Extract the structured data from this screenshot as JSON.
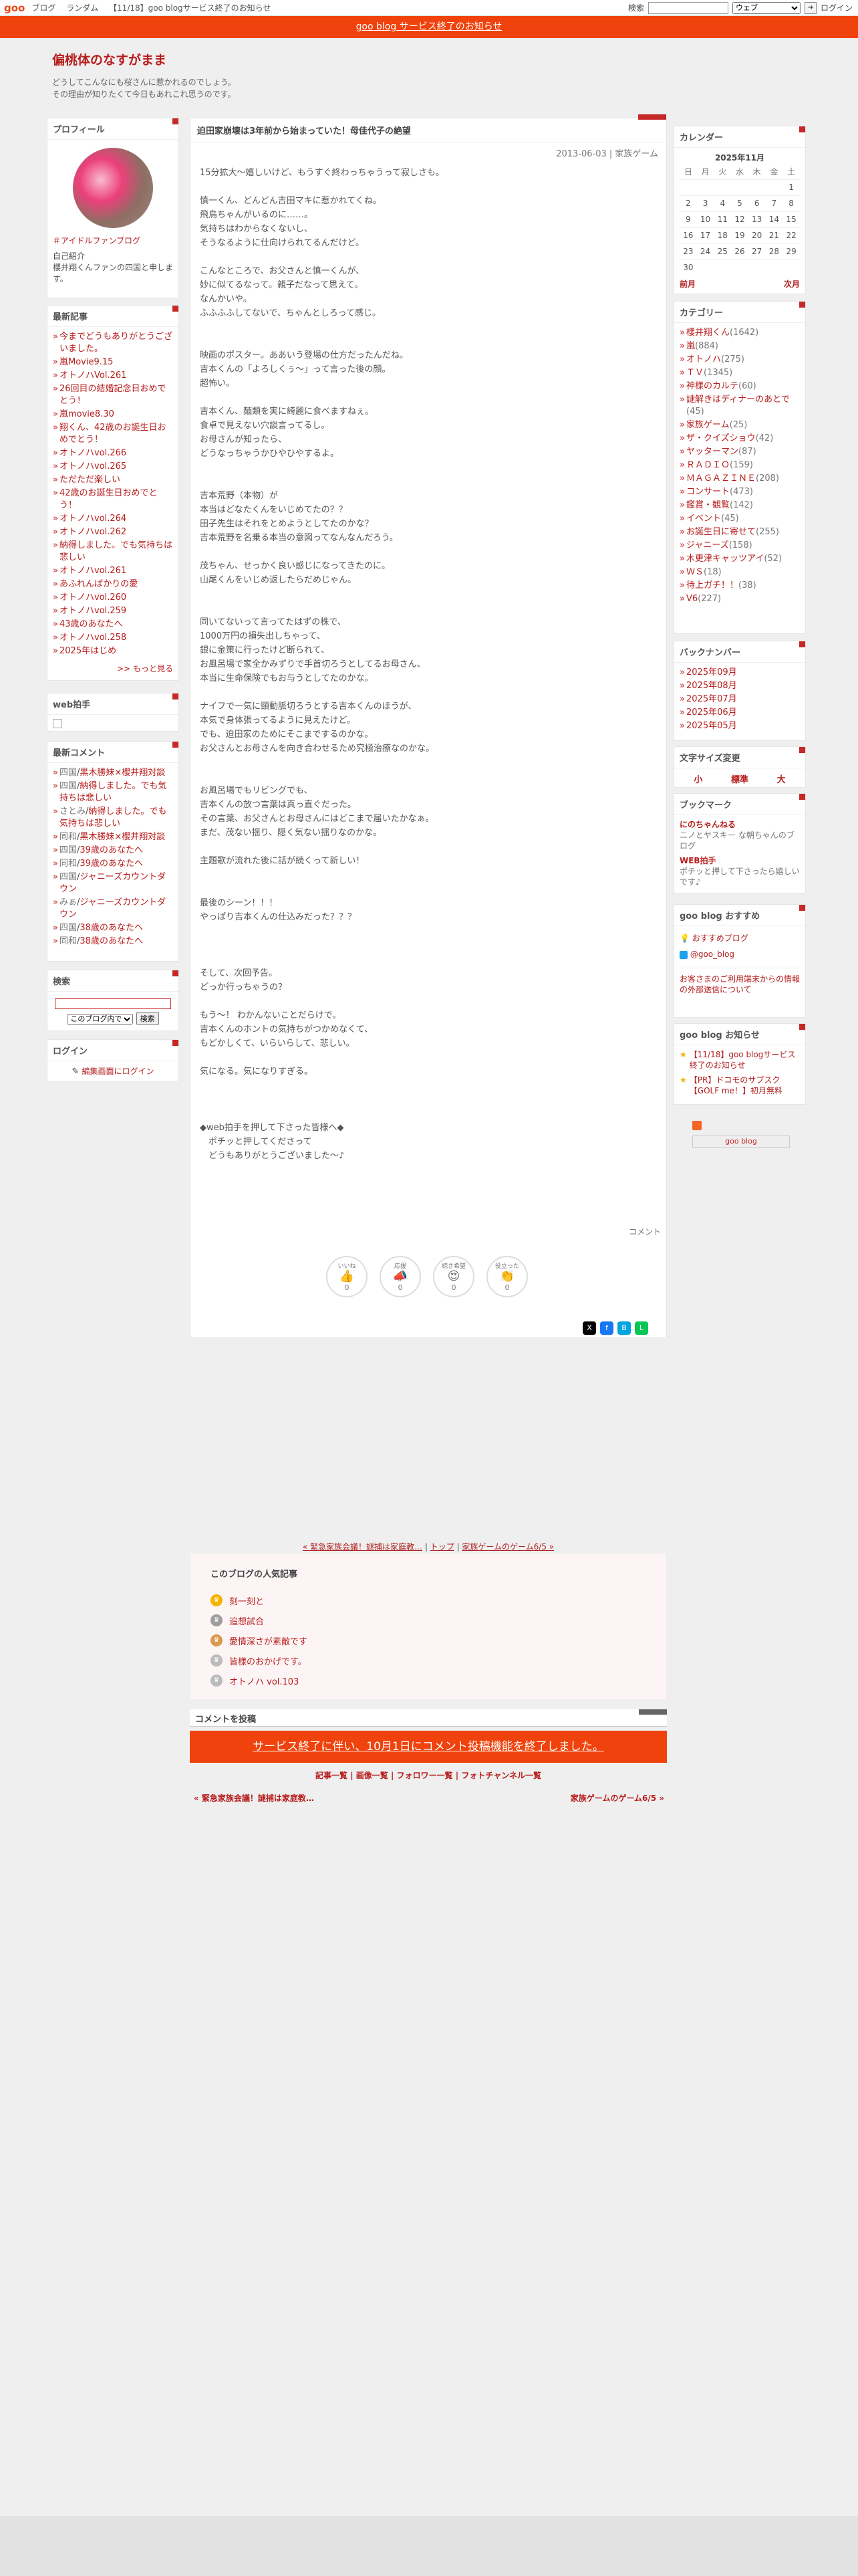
{
  "topbar": {
    "logo": "goo",
    "links": [
      "ブログ",
      "ランダム",
      "【11/18】goo blogサービス終了のお知らせ"
    ],
    "search_label": "検索",
    "select": "ウェブ",
    "login": "ログイン"
  },
  "notice": "goo blog サービス終了のお知らせ",
  "blog": {
    "title": "偏桃体のなすがまま",
    "desc1": "どうしてこんなにも桜さんに惹かれるのでしょう。",
    "desc2": "その理由が知りたくて今日もあれこれ思うのです。"
  },
  "profile": {
    "header": "プロフィール",
    "tag": "＃アイドルファンブログ",
    "intro_label": "自己紹介",
    "intro": "櫻井翔くんファンの四国と申します。"
  },
  "recent": {
    "header": "最新記事",
    "items": [
      "今までどうもありがとうございました。",
      "嵐Movie9.15",
      "オトノハVol.261",
      "26回目の結婚記念日おめでとう！",
      "嵐movie8.30",
      "翔くん、42歳のお誕生日おめでとう！",
      "オトノハvol.266",
      "オトノハvol.265",
      "ただただ楽しい",
      "42歳のお誕生日おめでとう！",
      "オトノハvol.264",
      "オトノハvol.262",
      "納得しました。でも気持ちは悲しい",
      "オトノハvol.261",
      "あふれんばかりの愛",
      "オトノハvol.260",
      "オトノハvol.259",
      "43歳のあなたへ",
      "オトノハvol.258",
      "2025年はじめ"
    ],
    "more": ">> もっと見る"
  },
  "clap": {
    "header": "web拍手"
  },
  "comments": {
    "header": "最新コメント",
    "items": [
      {
        "who": "四国",
        "what": "黒木勝妹×櫻井翔対談"
      },
      {
        "who": "四国",
        "what": "納得しました。でも気持ちは悲しい"
      },
      {
        "who": "さとみ",
        "what": "納得しました。でも気持ちは悲しい"
      },
      {
        "who": "同和",
        "what": "黒木勝妹×櫻井翔対談"
      },
      {
        "who": "四国",
        "what": "39歳のあなたへ"
      },
      {
        "who": "同和",
        "what": "39歳のあなたへ"
      },
      {
        "who": "四国",
        "what": "ジャニーズカウントダウン"
      },
      {
        "who": "みぁ",
        "what": "ジャニーズカウントダウン"
      },
      {
        "who": "四国",
        "what": "38歳のあなたへ"
      },
      {
        "who": "同和",
        "what": "38歳のあなたへ"
      }
    ]
  },
  "search": {
    "header": "検索",
    "select": "このブログ内で",
    "btn": "検索"
  },
  "login": {
    "header": "ログイン",
    "link": "編集画面にログイン"
  },
  "article": {
    "title": "迫田家崩壊は3年前から始まっていた！母佳代子の絶望",
    "date": "2013-06-03 | 家族ゲーム",
    "body": "15分拡大〜嬉しいけど、もうすぐ終わっちゃうって寂しさも。\n\n慎一くん、どんどん吉田マキに惹かれてくね。\n飛鳥ちゃんがいるのに……。\n気持ちはわからなくないし、\nそうなるように仕向けられてるんだけど。\n\nこんなところで、お父さんと慎一くんが、\n妙に似てるなって。親子だなって思えて。\nなんかいや。\nふふふふしてないで、ちゃんとしろって感じ。\n\n\n映画のポスター。ああいう登場の仕方だったんだね。\n吉本くんの「よろしくぅ〜」って言った後の顔。\n超怖い。\n\n吉本くん、麺類を実に綺麗に食べますねぇ。\n食卓で見えない穴談言ってるし。\nお母さんが知ったら、\nどうなっちゃうかひやひやするよ。\n\n\n吉本荒野（本物）が\n本当はどなたくんをいじめてたの？？\n田子先生はそれをとめようとしてたのかな？\n吉本荒野を名乗る本当の意図ってなんなんだろう。\n\n茂ちゃん、せっかく良い感じになってきたのに。\n山尾くんをいじめ返したらだめじゃん。\n\n\n同いてないって言ってたはずの株で、\n1000万円の損失出しちゃって、\n銀に金策に行ったけど断られて、\nお風呂場で家全かみずりで手首切ろうとしてるお母さん、\n本当に生命保険でもお与うとしてたのかな。\n\nナイフで一気に頸動脈切ろうとする吉本くんのほうが、\n本気で身体張ってるように見えたけど。\nでも、迫田家のためにそこまでするのかな。\nお父さんとお母さんを向き合わせるため究極治療なのかな。\n\n\nお風呂場でもリビングでも、\n吉本くんの放つ言葉は真っ直ぐだった。\nその言葉、お父さんとお母さんにはどこまで届いたかなぁ。\nまだ、茂ない揺り、隠く気ない揺りなのかな。\n\n主題歌が流れた後に話が続くって新しい！\n\n\n最後のシーン！！！\nやっぱり吉本くんの仕込みだった？？？\n\n\n\nそして、次回予告。\nどっか行っちゃうの？\n\nもう～！ わかんないことだらけで。\n吉本くんのホントの気持ちがつかめなくて、\nもどかしくて、いらいらして、悲しい。\n\n気になる。気になりすぎる。\n\n\n\n◆web拍手を押して下さった皆様へ◆\n　ポチッと押してくださって\n　どうもありがとうございました〜♪",
    "comment_link": "コメント"
  },
  "reactions": [
    {
      "label": "いいね",
      "icon": "👍",
      "count": "0"
    },
    {
      "label": "応援",
      "icon": "📣",
      "count": "0"
    },
    {
      "label": "続き希望",
      "icon": "😍",
      "count": "0"
    },
    {
      "label": "役立った",
      "icon": "👏",
      "count": "0"
    }
  ],
  "nav": {
    "prev": "« 緊急家族会議！謎捕は家庭教…",
    "sep1": " | ",
    "top": "トップ",
    "sep2": " | ",
    "next": "家族ゲームのゲーム6/5 »"
  },
  "popular": {
    "header": "このブログの人気記事",
    "items": [
      "刻一刻と",
      "追想試合",
      "愛情深さが素敵です",
      "皆様のおかげです。",
      "オトノハ vol.103"
    ],
    "colors": [
      "#f4b400",
      "#9e9e9e",
      "#d99a4e",
      "#bbbbbb",
      "#bbbbbb"
    ]
  },
  "comment_section": {
    "header": "コメントを投稿",
    "closed": "サービス終了に伴い、10月1日にコメント投稿機能を終了しました。"
  },
  "footer_links": {
    "items": [
      "記事一覧",
      "画像一覧",
      "フォロワー一覧",
      "フォトチャンネル一覧"
    ],
    "prev": "« 緊急家族会議！謎捕は家庭教…",
    "next": "家族ゲームのゲーム6/5 »"
  },
  "calendar": {
    "header": "カレンダー",
    "month": "2025年11月",
    "dow": [
      "日",
      "月",
      "火",
      "水",
      "木",
      "金",
      "土"
    ],
    "weeks": [
      [
        "",
        "",
        "",
        "",
        "",
        "",
        "1"
      ],
      [
        "2",
        "3",
        "4",
        "5",
        "6",
        "7",
        "8"
      ],
      [
        "9",
        "10",
        "11",
        "12",
        "13",
        "14",
        "15"
      ],
      [
        "16",
        "17",
        "18",
        "19",
        "20",
        "21",
        "22"
      ],
      [
        "23",
        "24",
        "25",
        "26",
        "27",
        "28",
        "29"
      ],
      [
        "30",
        "",
        "",
        "",
        "",
        "",
        ""
      ]
    ],
    "prev": "前月",
    "next": "次月"
  },
  "categories": {
    "header": "カテゴリー",
    "items": [
      {
        "n": "櫻井翔くん",
        "c": "(1642)"
      },
      {
        "n": "嵐",
        "c": "(884)"
      },
      {
        "n": "オトノハ",
        "c": "(275)"
      },
      {
        "n": "ＴＶ",
        "c": "(1345)"
      },
      {
        "n": "神様のカルテ",
        "c": "(60)"
      },
      {
        "n": "謎解きはディナーのあとで",
        "c": "(45)"
      },
      {
        "n": "家族ゲーム",
        "c": "(25)"
      },
      {
        "n": "ザ・クイズショウ",
        "c": "(42)"
      },
      {
        "n": "ヤッターマン",
        "c": "(87)"
      },
      {
        "n": "ＲＡＤＩＯ",
        "c": "(159)"
      },
      {
        "n": "ＭＡＧＡＺＩＮＥ",
        "c": "(208)"
      },
      {
        "n": "コンサート",
        "c": "(473)"
      },
      {
        "n": "鑑賞・観覧",
        "c": "(142)"
      },
      {
        "n": "イベント",
        "c": "(45)"
      },
      {
        "n": "お誕生日に寄せて",
        "c": "(255)"
      },
      {
        "n": "ジャニーズ",
        "c": "(158)"
      },
      {
        "n": "木更津キャッツアイ",
        "c": "(52)"
      },
      {
        "n": "ＷＳ",
        "c": "(18)"
      },
      {
        "n": "待上ガチ！！",
        "c": "(38)"
      },
      {
        "n": "V6",
        "c": "(227)"
      }
    ]
  },
  "backnumber": {
    "header": "バックナンバー",
    "items": [
      "2025年09月",
      "2025年08月",
      "2025年07月",
      "2025年06月",
      "2025年05月"
    ]
  },
  "fontsize": {
    "header": "文字サイズ変更",
    "items": [
      "小",
      "標準",
      "大"
    ]
  },
  "bookmark": {
    "header": "ブックマーク",
    "items": [
      {
        "t": "にのちゃんねる",
        "d": "ニノとヤスキー な朝ちゃんのブログ"
      },
      {
        "t": "WEB拍手",
        "d": "ポチッと押して下さったら嬉しいです♪"
      }
    ]
  },
  "recommend": {
    "header": "goo blog おすすめ",
    "items": [
      "おすすめブログ",
      "@goo_blog"
    ],
    "note": "お客さまのご利用端末からの情報の外部送信について"
  },
  "oshirase": {
    "header": "goo blog お知らせ",
    "items": [
      "【11/18】goo blogサービス終了のお知らせ",
      "【PR】ドコモのサブスク【GOLF me！】初月無料"
    ]
  },
  "badge": {
    "rss": "RSS",
    "gooblog": "goo blog"
  }
}
